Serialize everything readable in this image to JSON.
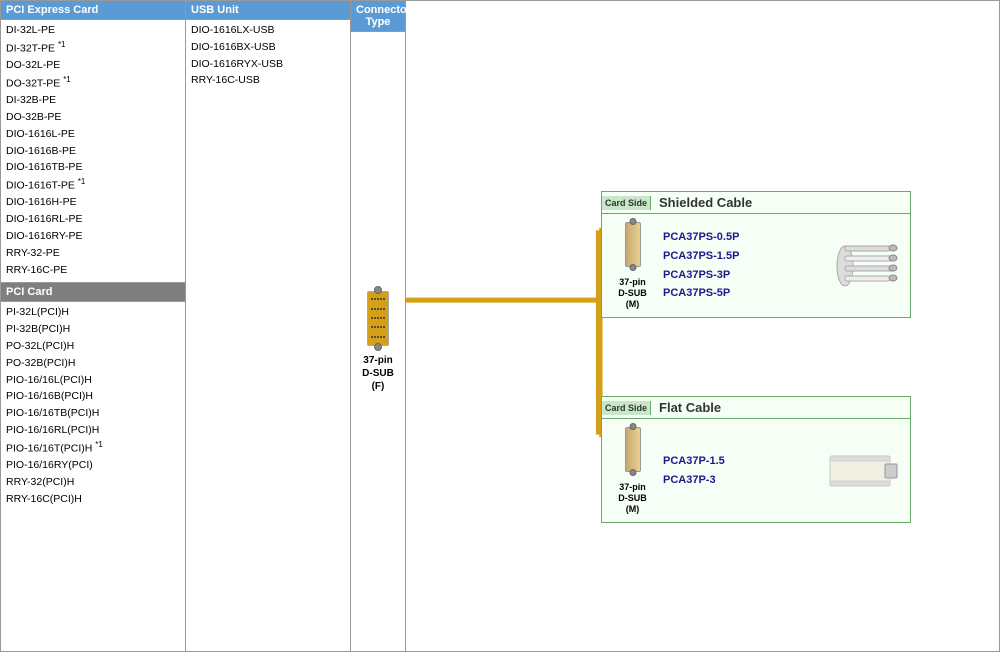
{
  "pci_express": {
    "header": "PCI Express Card",
    "items": [
      {
        "label": "DI-32L-PE",
        "sup": ""
      },
      {
        "label": "DI-32T-PE",
        "sup": "1"
      },
      {
        "label": "DO-32L-PE",
        "sup": ""
      },
      {
        "label": "DO-32T-PE",
        "sup": "1"
      },
      {
        "label": "DI-32B-PE",
        "sup": ""
      },
      {
        "label": "DO-32B-PE",
        "sup": ""
      },
      {
        "label": "DIO-1616L-PE",
        "sup": ""
      },
      {
        "label": "DIO-1616B-PE",
        "sup": ""
      },
      {
        "label": "DIO-1616TB-PE",
        "sup": ""
      },
      {
        "label": "DIO-1616T-PE",
        "sup": "1"
      },
      {
        "label": "DIO-1616H-PE",
        "sup": ""
      },
      {
        "label": "DIO-1616RL-PE",
        "sup": ""
      },
      {
        "label": "DIO-1616RY-PE",
        "sup": ""
      },
      {
        "label": "RRY-32-PE",
        "sup": ""
      },
      {
        "label": "RRY-16C-PE",
        "sup": ""
      }
    ]
  },
  "pci_card": {
    "header": "PCI Card",
    "items": [
      {
        "label": "PI-32L(PCI)H",
        "sup": ""
      },
      {
        "label": "PI-32B(PCI)H",
        "sup": ""
      },
      {
        "label": "PO-32L(PCI)H",
        "sup": ""
      },
      {
        "label": "PO-32B(PCI)H",
        "sup": ""
      },
      {
        "label": "PIO-16/16L(PCI)H",
        "sup": ""
      },
      {
        "label": "PIO-16/16B(PCI)H",
        "sup": ""
      },
      {
        "label": "PIO-16/16TB(PCI)H",
        "sup": ""
      },
      {
        "label": "PIO-16/16RL(PCI)H",
        "sup": ""
      },
      {
        "label": "PIO-16/16T(PCI)H",
        "sup": "1"
      },
      {
        "label": "PIO-16/16RY(PCI)",
        "sup": ""
      },
      {
        "label": "RRY-32(PCI)H",
        "sup": ""
      },
      {
        "label": "RRY-16C(PCI)H",
        "sup": ""
      }
    ]
  },
  "usb_unit": {
    "header": "USB Unit",
    "items": [
      "DIO-1616LX-USB",
      "DIO-1616BX-USB",
      "DIO-1616RYX-USB",
      "RRY-16C-USB"
    ]
  },
  "connector_type": {
    "header": "Connector Type",
    "label_line1": "37-pin",
    "label_line2": "D-SUB",
    "label_line3": "(F)"
  },
  "shielded_cable": {
    "title": "Shielded Cable",
    "card_side_label": "Card Side",
    "connector_label_line1": "37-pin",
    "connector_label_line2": "D-SUB",
    "connector_label_line3": "(M)",
    "products": [
      "PCA37PS-0.5P",
      "PCA37PS-1.5P",
      "PCA37PS-3P",
      "PCA37PS-5P"
    ]
  },
  "flat_cable": {
    "title": "Flat Cable",
    "card_side_label": "Card Side",
    "connector_label_line1": "37-pin",
    "connector_label_line2": "D-SUB",
    "connector_label_line3": "(M)",
    "products": [
      "PCA37P-1.5",
      "PCA37P-3"
    ]
  }
}
